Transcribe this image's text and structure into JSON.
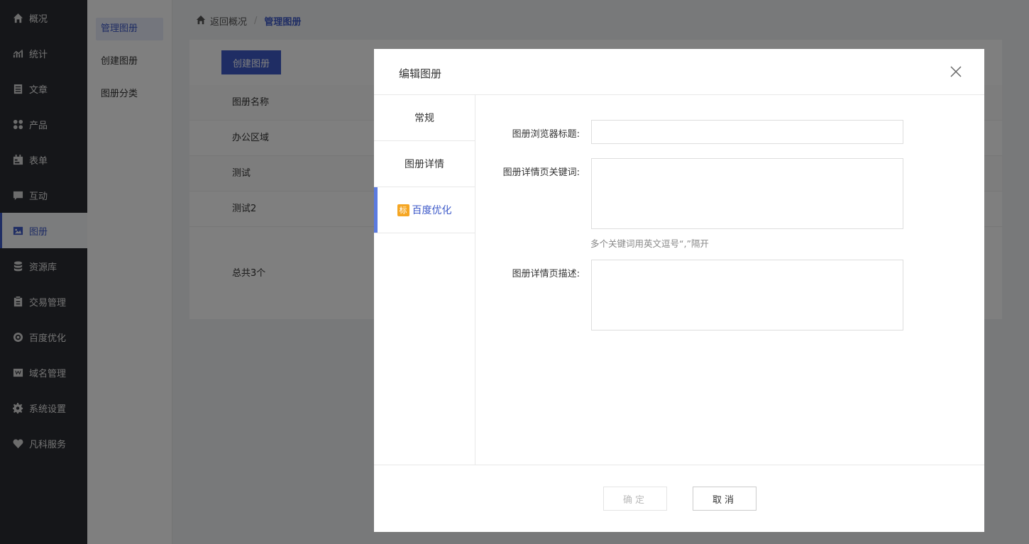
{
  "sidenav": {
    "items": [
      {
        "label": "概况",
        "icon": "home-icon"
      },
      {
        "label": "统计",
        "icon": "chart-icon"
      },
      {
        "label": "文章",
        "icon": "article-icon"
      },
      {
        "label": "产品",
        "icon": "grid-icon"
      },
      {
        "label": "表单",
        "icon": "calendar-icon"
      },
      {
        "label": "互动",
        "icon": "comment-icon"
      },
      {
        "label": "图册",
        "icon": "gallery-icon",
        "active": true
      },
      {
        "label": "资源库",
        "icon": "database-icon"
      },
      {
        "label": "交易管理",
        "icon": "clipboard-icon"
      },
      {
        "label": "百度优化",
        "icon": "target-icon"
      },
      {
        "label": "域名管理",
        "icon": "w-icon"
      },
      {
        "label": "系统设置",
        "icon": "gear-icon"
      },
      {
        "label": "凡科服务",
        "icon": "heart-icon"
      }
    ]
  },
  "subnav": {
    "items": [
      "管理图册",
      "创建图册",
      "图册分类"
    ]
  },
  "breadcrumb": {
    "back": "返回概况",
    "separator": "/",
    "current": "管理图册"
  },
  "panel": {
    "create_button": "创建图册",
    "table": {
      "header": "图册名称",
      "rows": [
        "办公区域",
        "测试",
        "测试2"
      ]
    },
    "total": "总共3个"
  },
  "dialog": {
    "title": "编辑图册",
    "tabs": [
      "常规",
      "图册详情",
      "百度优化"
    ],
    "tag_icon_text": "标",
    "form": {
      "browser_title_label": "图册浏览器标题:",
      "keywords_label": "图册详情页关键词:",
      "keywords_hint": "多个关键词用英文逗号“,”隔开",
      "description_label": "图册详情页描述:"
    },
    "ok_button": "确定",
    "cancel_button": "取消"
  },
  "colors": {
    "accent": "#3e5ac9",
    "sidenav_bg": "#2b2d33",
    "tag": "#f5a623"
  }
}
